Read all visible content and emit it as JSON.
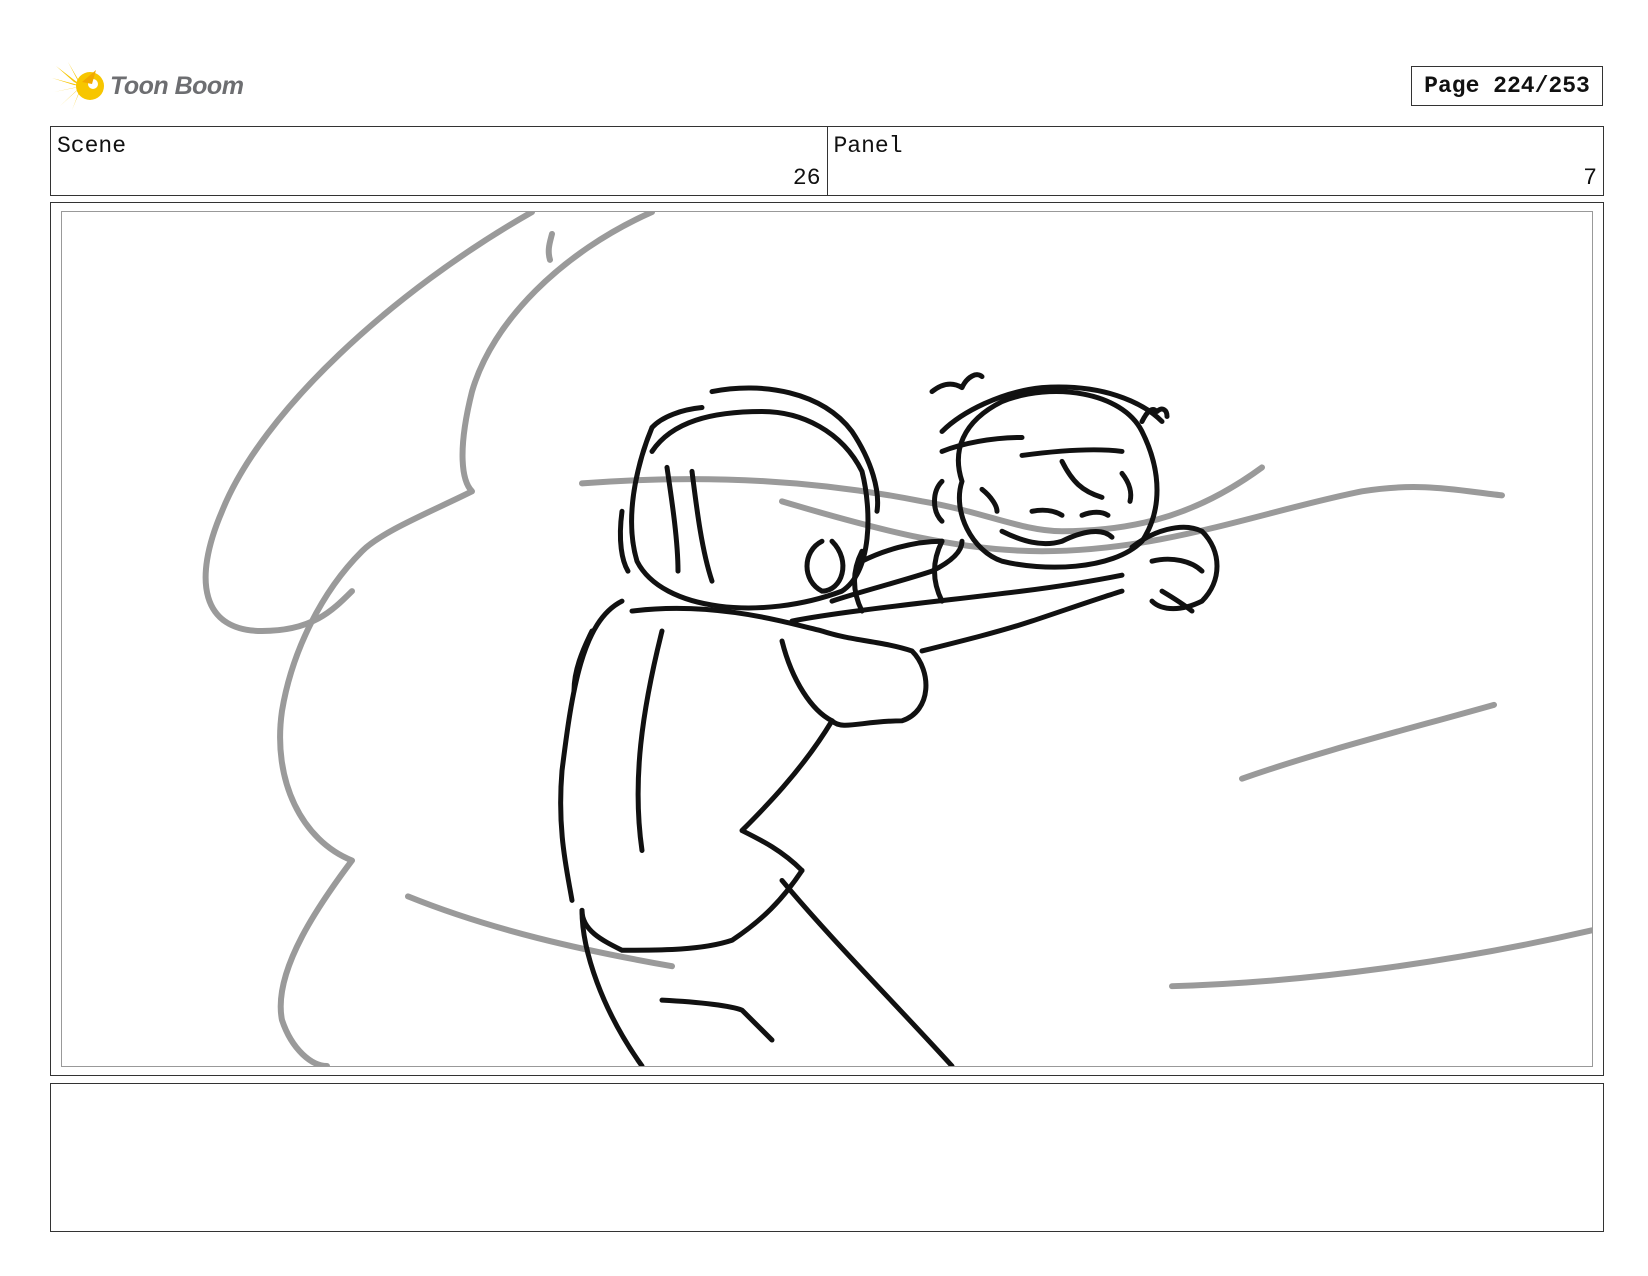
{
  "header": {
    "logo_text": "Toon Boom",
    "page_label": "Page 224/253"
  },
  "fields": {
    "scene_label": "Scene",
    "scene_value": "26",
    "panel_label": "Panel",
    "panel_value": "7"
  },
  "panel": {
    "image": "storyboard-sketch",
    "sketch_color": "#111111",
    "motion_line_color": "#9a9a9a"
  },
  "notes": {
    "text": ""
  },
  "colors": {
    "logo_star": "#f7c600",
    "logo_text": "#6d6e71",
    "border": "#333333"
  }
}
